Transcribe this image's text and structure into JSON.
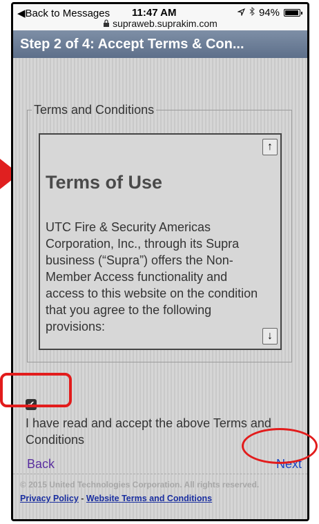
{
  "status_bar": {
    "back": "◀Back to Messages",
    "time": "11:47 AM",
    "battery": "94%",
    "battery_level": 0.94,
    "url": "supraweb.suprakim.com"
  },
  "header": {
    "title": "Step 2 of 4: Accept Terms & Con..."
  },
  "terms": {
    "legend": "Terms and Conditions",
    "heading": "Terms of Use",
    "body": "UTC Fire & Security Americas Corporation, Inc., through its Supra business (“Supra”) offers the Non-Member Access functionality and access to this website on the condition that you agree to the following provisions:",
    "scroll_up": "↑",
    "scroll_down": "↓"
  },
  "accept": {
    "checked": true,
    "check_glyph": "✔",
    "label": "I have read and accept the above Terms and Conditions"
  },
  "nav": {
    "back": "Back",
    "next": "Next"
  },
  "footer": {
    "copyright": "© 2015 United Technologies Corporation. All rights reserved.",
    "privacy": "Privacy Policy",
    "separator": "-",
    "terms_link": "Website Terms and Conditions"
  },
  "icons": {
    "lock": "lock-icon",
    "location": "location-arrow-icon",
    "bluetooth": "bluetooth-icon",
    "battery": "battery-icon"
  },
  "annotation_color": "#e21c1c"
}
